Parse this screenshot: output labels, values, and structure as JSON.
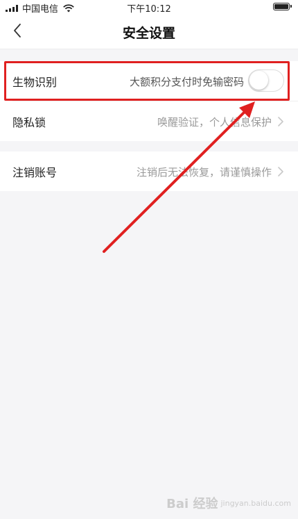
{
  "status_bar": {
    "carrier": "中国电信",
    "time": "下午10:12"
  },
  "nav": {
    "title": "安全设置"
  },
  "settings": {
    "biometric": {
      "label": "生物识别",
      "description": "大额积分支付时免输密码",
      "toggle_on": false
    },
    "privacy_lock": {
      "label": "隐私锁",
      "value": "唤醒验证，个人信息保护"
    },
    "cancel_account": {
      "label": "注销账号",
      "value": "注销后无法恢复，请谨慎操作"
    }
  },
  "annotation": {
    "highlight_color": "#e02020",
    "arrow_color": "#e02020"
  },
  "watermark": {
    "text": "Bai 经验",
    "sub": "jingyan.baidu.com"
  }
}
